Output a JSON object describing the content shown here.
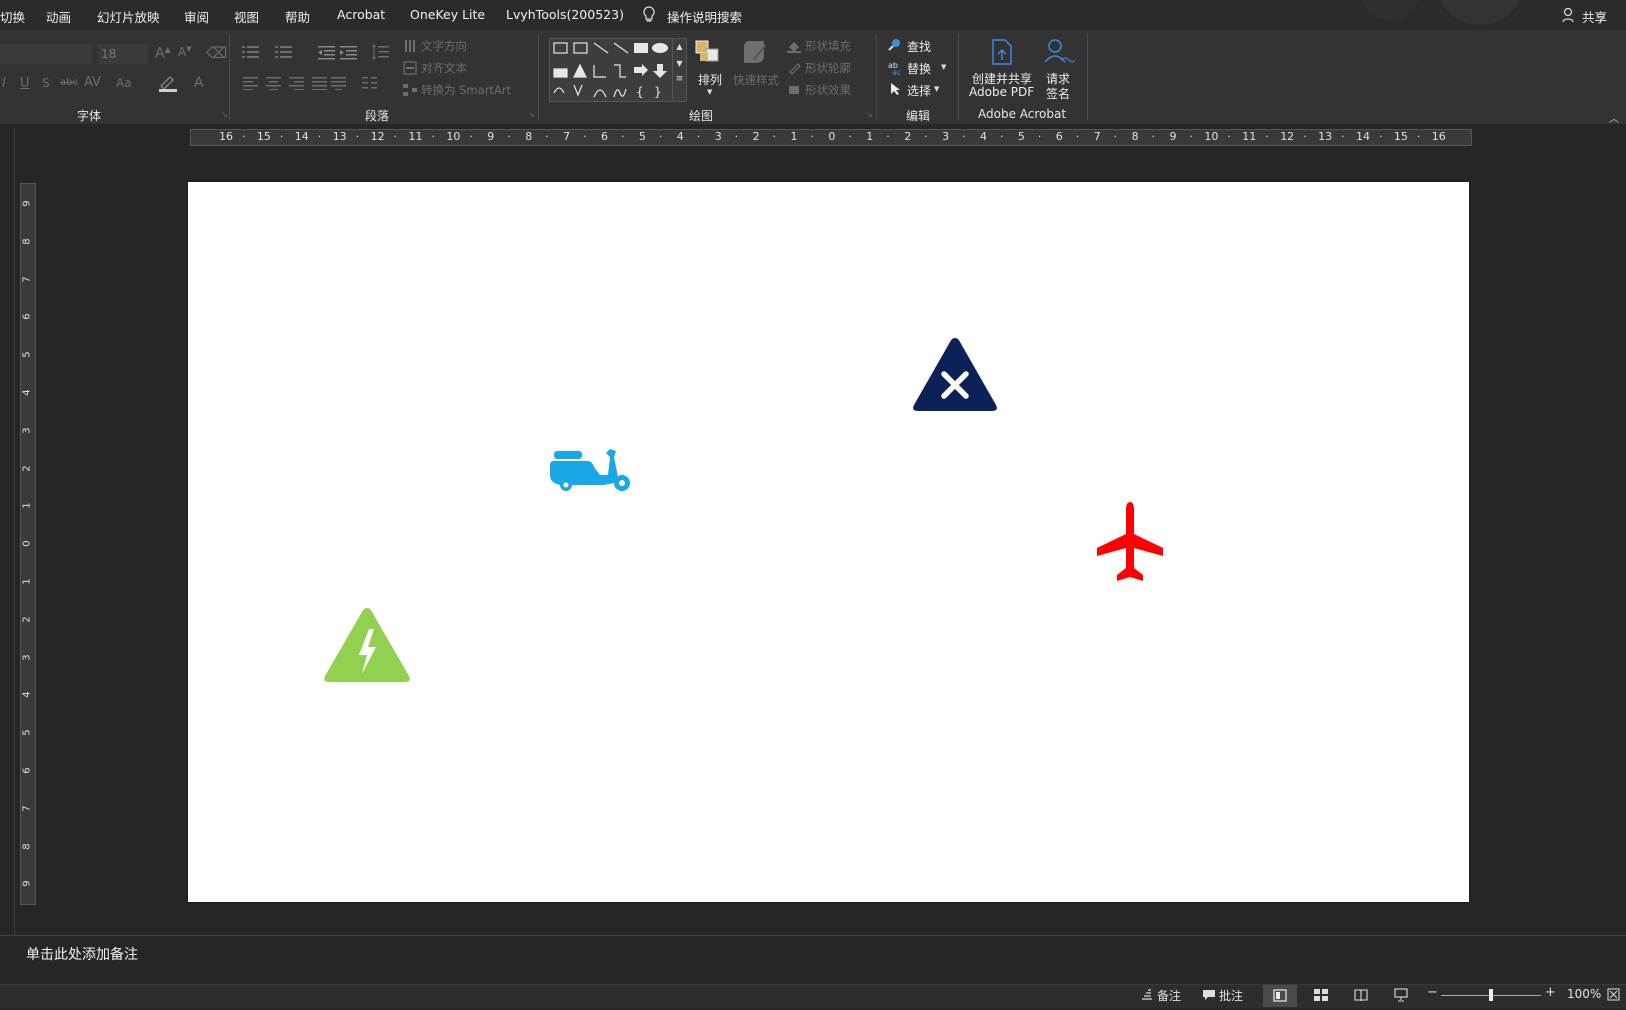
{
  "menu": {
    "tabs": [
      "切换",
      "动画",
      "幻灯片放映",
      "审阅",
      "视图",
      "帮助",
      "Acrobat",
      "OneKey Lite",
      "LvyhTools(200523)"
    ],
    "search_label": "操作说明搜索",
    "share_label": "共享"
  },
  "ribbon": {
    "font_size": "18",
    "groups": {
      "font": "字体",
      "paragraph": "段落",
      "drawing": "绘图",
      "editing": "编辑",
      "acrobat": "Adobe Acrobat"
    },
    "paragraph": {
      "text_direction": "文字方向",
      "align_text": "对齐文本",
      "convert_smartart": "转换为 SmartArt"
    },
    "drawing": {
      "arrange": "排列",
      "quick_styles": "快速样式",
      "shape_fill": "形状填充",
      "shape_outline": "形状轮廓",
      "shape_effects": "形状效果"
    },
    "editing": {
      "find": "查找",
      "replace": "替换",
      "select": "选择"
    },
    "acrobat": {
      "create_share_line1": "创建并共享",
      "create_share_line2": "Adobe PDF",
      "request_sign_line1": "请求",
      "request_sign_line2": "签名"
    }
  },
  "ruler": {
    "horizontal": [
      "16",
      "15",
      "14",
      "13",
      "12",
      "11",
      "10",
      "9",
      "8",
      "7",
      "6",
      "5",
      "4",
      "3",
      "2",
      "1",
      "0",
      "1",
      "2",
      "3",
      "4",
      "5",
      "6",
      "7",
      "8",
      "9",
      "10",
      "11",
      "12",
      "13",
      "14",
      "15",
      "16"
    ],
    "vertical": [
      "9",
      "8",
      "7",
      "6",
      "5",
      "4",
      "3",
      "2",
      "1",
      "0",
      "1",
      "2",
      "3",
      "4",
      "5",
      "6",
      "7",
      "8",
      "9"
    ]
  },
  "slide": {
    "icons": [
      {
        "name": "x-warning-triangle-icon",
        "color": "#0d2159"
      },
      {
        "name": "scooter-icon",
        "color": "#1aa7e8"
      },
      {
        "name": "airplane-icon",
        "color": "#ff0000"
      },
      {
        "name": "high-voltage-triangle-icon",
        "color": "#92d050"
      }
    ]
  },
  "notes_placeholder": "单击此处添加备注",
  "status": {
    "notes": "备注",
    "comments": "批注",
    "zoom": "100%"
  }
}
